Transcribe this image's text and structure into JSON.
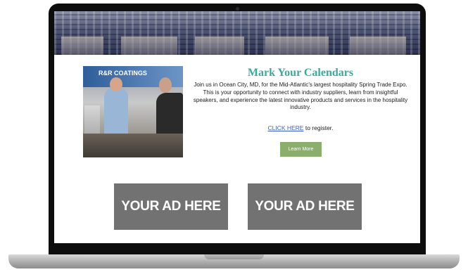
{
  "hero": {
    "title": "Mark Your Calendars",
    "description": "Join us in Ocean City, MD, for the Mid-Atlantic's largest hospitality Spring Trade Expo. This is your opportunity to connect with industry suppliers, learn from insightful speakers, and experience the latest innovative products and services in the hospitality industry.",
    "register_link": "CLICK HERE",
    "register_suffix": " to register.",
    "cta_label": "Learn More",
    "photo_sign_text": "R&R COATINGS"
  },
  "ads": [
    {
      "label": "YOUR AD HERE"
    },
    {
      "label": "YOUR AD HERE"
    }
  ],
  "colors": {
    "title": "#3aaa9a",
    "cta_background": "#8cae6c",
    "ad_background": "#727272",
    "link": "#3a5fc0"
  }
}
